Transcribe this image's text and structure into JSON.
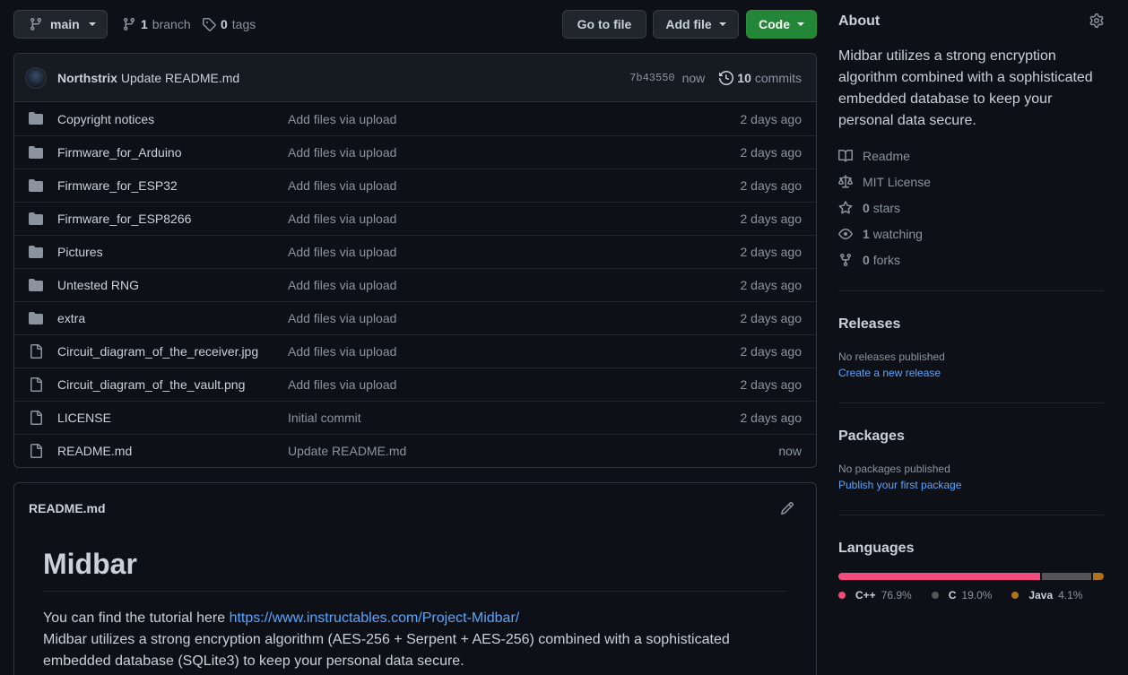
{
  "toolbar": {
    "branch_label": "main",
    "branches_count": "1",
    "branches_label": "branch",
    "tags_count": "0",
    "tags_label": "tags",
    "goto_file": "Go to file",
    "add_file": "Add file",
    "code": "Code"
  },
  "commit": {
    "author": "Northstrix",
    "message": "Update README.md",
    "hash": "7b43550",
    "time": "now",
    "count": "10",
    "count_label": "commits"
  },
  "files": [
    {
      "type": "dir",
      "name": "Copyright notices",
      "message": "Add files via upload",
      "age": "2 days ago"
    },
    {
      "type": "dir",
      "name": "Firmware_for_Arduino",
      "message": "Add files via upload",
      "age": "2 days ago"
    },
    {
      "type": "dir",
      "name": "Firmware_for_ESP32",
      "message": "Add files via upload",
      "age": "2 days ago"
    },
    {
      "type": "dir",
      "name": "Firmware_for_ESP8266",
      "message": "Add files via upload",
      "age": "2 days ago"
    },
    {
      "type": "dir",
      "name": "Pictures",
      "message": "Add files via upload",
      "age": "2 days ago"
    },
    {
      "type": "dir",
      "name": "Untested RNG",
      "message": "Add files via upload",
      "age": "2 days ago"
    },
    {
      "type": "dir",
      "name": "extra",
      "message": "Add files via upload",
      "age": "2 days ago"
    },
    {
      "type": "file",
      "name": "Circuit_diagram_of_the_receiver.jpg",
      "message": "Add files via upload",
      "age": "2 days ago"
    },
    {
      "type": "file",
      "name": "Circuit_diagram_of_the_vault.png",
      "message": "Add files via upload",
      "age": "2 days ago"
    },
    {
      "type": "file",
      "name": "LICENSE",
      "message": "Initial commit",
      "age": "2 days ago"
    },
    {
      "type": "file",
      "name": "README.md",
      "message": "Update README.md",
      "age": "now"
    }
  ],
  "readme": {
    "filename": "README.md",
    "title": "Midbar",
    "tutorial_prefix": "You can find the tutorial here ",
    "tutorial_link": "https://www.instructables.com/Project-Midbar/",
    "description": "Midbar utilizes a strong encryption algorithm (AES-256 + Serpent + AES-256) combined with a sophisticated embedded database (SQLite3) to keep your personal data secure."
  },
  "about": {
    "heading": "About",
    "description": "Midbar utilizes a strong encryption algorithm combined with a sophisticated embedded database to keep your personal data secure.",
    "readme": "Readme",
    "license": "MIT License",
    "stars_count": "0",
    "stars_label": "stars",
    "watching_count": "1",
    "watching_label": "watching",
    "forks_count": "0",
    "forks_label": "forks"
  },
  "releases": {
    "heading": "Releases",
    "none": "No releases published",
    "create": "Create a new release"
  },
  "packages": {
    "heading": "Packages",
    "none": "No packages published",
    "publish": "Publish your first package"
  },
  "languages": {
    "heading": "Languages",
    "items": [
      {
        "name": "C++",
        "percent": "76.9%",
        "value": 76.9,
        "color": "#f34b7d"
      },
      {
        "name": "C",
        "percent": "19.0%",
        "value": 19.0,
        "color": "#555555"
      },
      {
        "name": "Java",
        "percent": "4.1%",
        "value": 4.1,
        "color": "#b07219"
      }
    ]
  },
  "colors": {
    "background": "#0d1117",
    "accent_green": "#238636",
    "link": "#58a6ff",
    "border": "#30363d"
  }
}
